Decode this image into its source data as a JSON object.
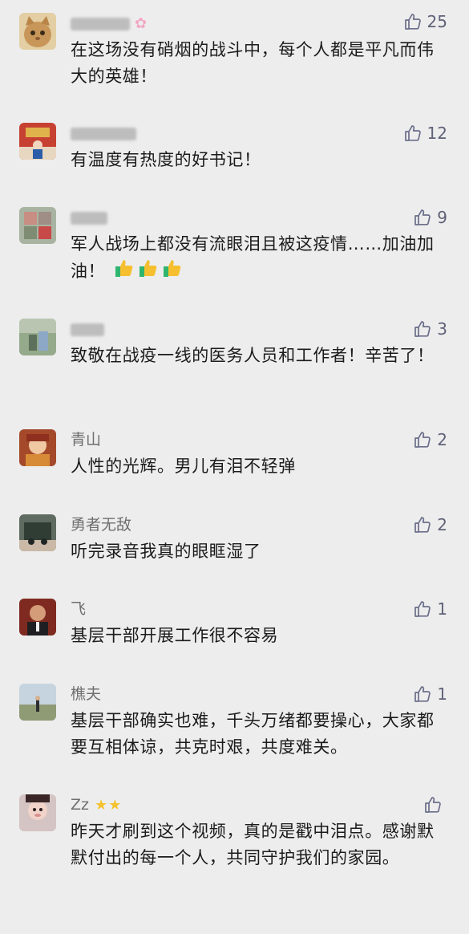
{
  "comments": [
    {
      "author": "",
      "text": "在这场没有硝烟的战斗中，每个人都是平凡而伟大的英雄！",
      "likes": "25",
      "avatar": "cat-avatar",
      "author_obscured": true
    },
    {
      "author": "",
      "text": "有温度有热度的好书记！",
      "likes": "12",
      "avatar": "photo-avatar",
      "author_obscured": true
    },
    {
      "author": "",
      "text": "军人战场上都没有流眼泪且被这疫情……加油加油！",
      "likes": "9",
      "avatar": "photo-avatar",
      "author_obscured": true,
      "emoji": [
        "thumbs-up",
        "thumbs-up",
        "thumbs-up"
      ]
    },
    {
      "author": "",
      "text": "致敬在战疫一线的医务人员和工作者！辛苦了！",
      "likes": "3",
      "avatar": "photo-avatar",
      "author_obscured": true
    },
    {
      "author": "青山",
      "text": "人性的光辉。男儿有泪不轻弹",
      "likes": "2",
      "avatar": "illustration-avatar"
    },
    {
      "author": "勇者无敌",
      "text": "听完录音我真的眼眶湿了",
      "likes": "2",
      "avatar": "photo-avatar"
    },
    {
      "author": "飞",
      "text": "基层干部开展工作很不容易",
      "likes": "1",
      "avatar": "portrait-avatar"
    },
    {
      "author": "樵夫",
      "text": "基层干部确实也难，千头万绪都要操心，大家都要互相体谅，共克时艰，共度难关。",
      "likes": "1",
      "avatar": "landscape-avatar"
    },
    {
      "author": "Zz",
      "text": "昨天才刷到这个视频，真的是戳中泪点。感谢默默付出的每一个人，共同守护我们的家园。",
      "likes": "",
      "avatar": "child-avatar",
      "emoji": [
        "star",
        "star"
      ]
    }
  ]
}
